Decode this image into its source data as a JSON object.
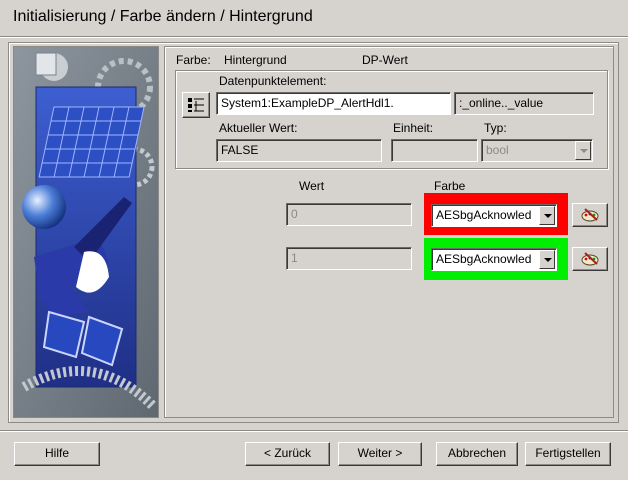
{
  "title": "Initialisierung / Farbe ändern / Hintergrund",
  "header": {
    "farbe_label": "Farbe:",
    "farbe_value": "Hintergrund",
    "dp_wert_label": "DP-Wert"
  },
  "group": {
    "dpe_label": "Datenpunktelement:",
    "dpe_value": "System1:ExampleDP_AlertHdl1.",
    "config_value": ":_online.._value",
    "aktueller_wert_label": "Aktueller Wert:",
    "aktueller_wert_value": "FALSE",
    "einheit_label": "Einheit:",
    "einheit_value": "",
    "typ_label": "Typ:",
    "typ_value": "bool"
  },
  "table": {
    "wert_header": "Wert",
    "farbe_header": "Farbe",
    "rows": [
      {
        "wert": "0",
        "farbe": "AESbgAcknowled",
        "color": "#ff0000"
      },
      {
        "wert": "1",
        "farbe": "AESbgAcknowled",
        "color": "#00ee00"
      }
    ]
  },
  "buttons": {
    "hilfe": "Hilfe",
    "zurueck": "< Zurück",
    "weiter": "Weiter >",
    "abbrechen": "Abbrechen",
    "fertigstellen": "Fertigstellen"
  }
}
